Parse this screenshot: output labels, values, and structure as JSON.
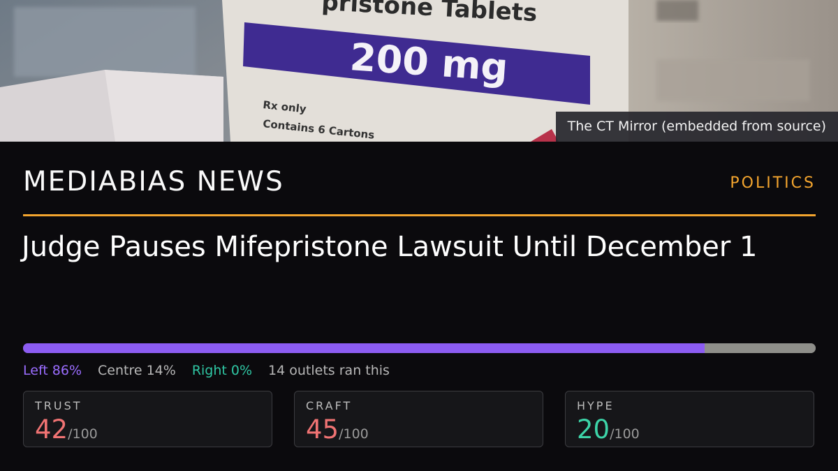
{
  "hero": {
    "caption": "The CT Mirror (embedded from source)",
    "box_text_top": "pristone Tablets",
    "box_dose": "200 mg",
    "box_line1": "Rx only",
    "box_line2": "Contains 6 Cartons"
  },
  "header": {
    "brand": "MEDIABIAS NEWS",
    "category": "POLITICS",
    "accent_color": "#f4a52e"
  },
  "article": {
    "headline": "Judge Pauses Mifepristone Lawsuit Until December 1"
  },
  "bias": {
    "left_pct": 86,
    "centre_pct": 14,
    "right_pct": 0,
    "left_label": "Left 86%",
    "centre_label": "Centre 14%",
    "right_label": "Right 0%",
    "outlets_label": "14 outlets ran this",
    "colors": {
      "left": "#8c5cf2",
      "centre": "#8f8f8a",
      "right": "#2bc4a0"
    }
  },
  "scores": [
    {
      "label": "TRUST",
      "value": "42",
      "outof": "/100",
      "color": "#f07373"
    },
    {
      "label": "CRAFT",
      "value": "45",
      "outof": "/100",
      "color": "#f07373"
    },
    {
      "label": "HYPE",
      "value": "20",
      "outof": "/100",
      "color": "#3dd4a8"
    }
  ]
}
